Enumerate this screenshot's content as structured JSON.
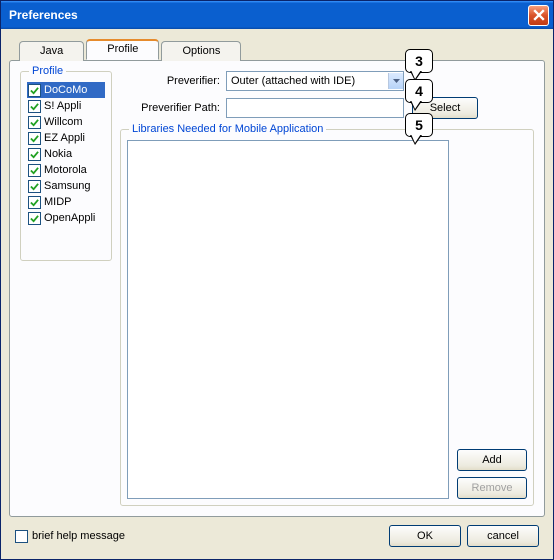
{
  "window": {
    "title": "Preferences"
  },
  "tabs": {
    "java": "Java",
    "profile": "Profile",
    "options": "Options"
  },
  "profile_group": {
    "legend": "Profile",
    "items": [
      {
        "label": "DoCoMo",
        "checked": true,
        "selected": true
      },
      {
        "label": "S! Appli",
        "checked": true,
        "selected": false
      },
      {
        "label": "Willcom",
        "checked": true,
        "selected": false
      },
      {
        "label": "EZ Appli",
        "checked": true,
        "selected": false
      },
      {
        "label": "Nokia",
        "checked": true,
        "selected": false
      },
      {
        "label": "Motorola",
        "checked": true,
        "selected": false
      },
      {
        "label": "Samsung",
        "checked": true,
        "selected": false
      },
      {
        "label": "MIDP",
        "checked": true,
        "selected": false
      },
      {
        "label": "OpenAppli",
        "checked": true,
        "selected": false
      }
    ]
  },
  "form": {
    "preverifier_label": "Preverifier:",
    "preverifier_value": "Outer (attached with IDE)",
    "path_label": "Preverifier Path:",
    "path_value": "",
    "select_btn": "Select"
  },
  "lib": {
    "legend": "Libraries Needed for Mobile Application",
    "add": "Add",
    "remove": "Remove"
  },
  "footer": {
    "brief": "brief help message",
    "ok": "OK",
    "cancel": "cancel"
  },
  "callouts": {
    "c3": "3",
    "c4": "4",
    "c5": "5"
  }
}
